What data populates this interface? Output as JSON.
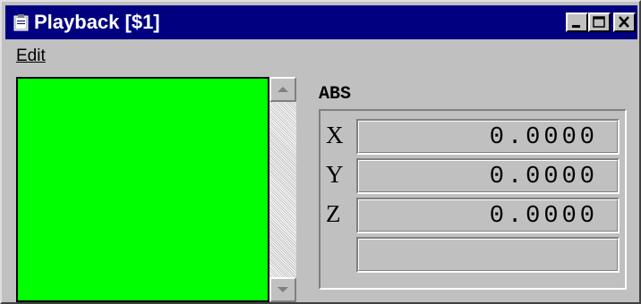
{
  "window": {
    "title": "Playback [$1]",
    "icon": "clipboard-icon",
    "controls": [
      "minimize-icon",
      "maximize-icon",
      "close-icon"
    ]
  },
  "menu": {
    "items": [
      {
        "label": "Edit"
      }
    ]
  },
  "canvas": {
    "color": "#00ff00"
  },
  "coordinates": {
    "mode_label": "ABS",
    "axes": [
      {
        "label": "X",
        "value": "0.0000"
      },
      {
        "label": "Y",
        "value": "0.0000"
      },
      {
        "label": "Z",
        "value": "0.0000"
      },
      {
        "label": "",
        "value": ""
      }
    ]
  },
  "colors": {
    "titlebar": "#000080",
    "face": "#c0c0c0",
    "canvas": "#00ff00"
  }
}
